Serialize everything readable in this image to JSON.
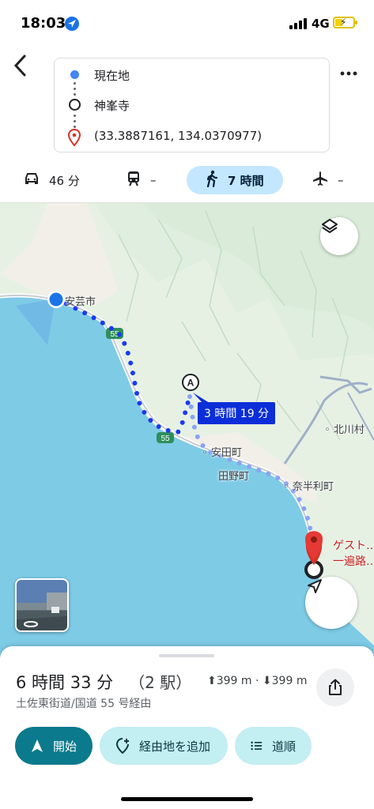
{
  "status_bar": {
    "time": "18:03",
    "network": "4G"
  },
  "header": {
    "origin": "現在地",
    "waypoint": "神峯寺",
    "destination": "(33.3887161, 134.0370977)"
  },
  "modes": [
    {
      "label": "46 分",
      "icon": "car-icon"
    },
    {
      "label": "–",
      "icon": "train-icon"
    },
    {
      "label": "7 時間",
      "icon": "walk-icon",
      "active": true
    },
    {
      "label": "–",
      "icon": "plane-icon"
    }
  ],
  "map": {
    "places": {
      "aki": "安芸市",
      "yasuda": "安田町",
      "tanno": "田野町",
      "nahari": "奈半利町",
      "kitagawa": "北川村"
    },
    "route_shields": [
      "55",
      "55"
    ],
    "waypoint_marker": "A",
    "route_duration": "3 時間 19 分",
    "destination_label": [
      "ゲスト…",
      "一遍路…"
    ]
  },
  "sheet": {
    "duration": "6 時間 33 分",
    "stations": "（2 駅）",
    "ascent": "399 m",
    "descent": "399 m",
    "via": "土佐東街道/国道 55 号経由",
    "start_label": "開始",
    "add_stop_label": "経由地を追加",
    "steps_label": "道順"
  },
  "colors": {
    "accent_teal": "#0b7a8c",
    "chip_light": "#c3eef2",
    "active_mode": "#c2e7ff",
    "route_blue": "#1a3af0",
    "route_light": "#8aa2f5",
    "destination_red": "#d93025",
    "sea": "#7ecbe6",
    "land": "#e6f1e4"
  }
}
